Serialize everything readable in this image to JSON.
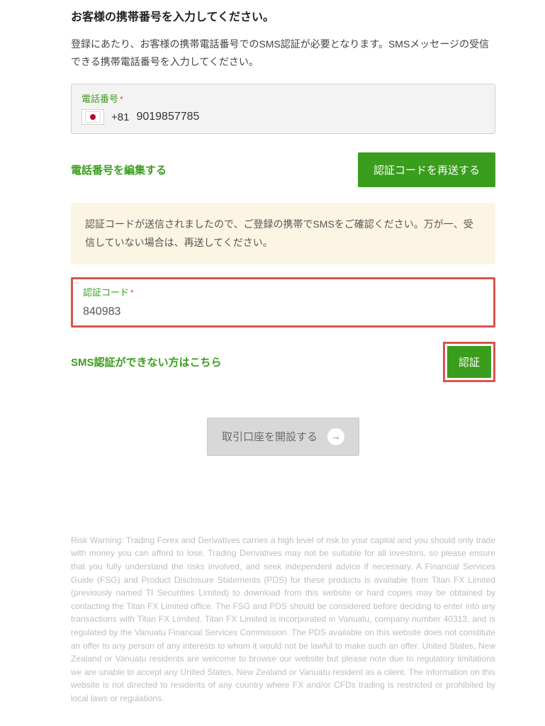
{
  "heading": "お客様の携帯番号を入力してください。",
  "description": "登録にあたり、お客様の携帯電話番号でのSMS認証が必要となります。SMSメッセージの受信できる携帯電話番号を入力してください。",
  "phone": {
    "label": "電話番号",
    "required": "*",
    "country_code": "+81",
    "number": "9019857785"
  },
  "edit_phone_link": "電話番号を編集する",
  "resend_button": "認証コードを再送する",
  "alert": "認証コードが送信されましたので、ご登録の携帯でSMSをご確認ください。万が一、受信していない場合は、再送してください。",
  "code": {
    "label": "認証コード",
    "required": "*",
    "value": "840983"
  },
  "alt_link": "SMS認証ができない方はこちら",
  "verify_button": "認証",
  "open_account_button": "取引口座を開設する",
  "risk_warning": "Risk Warning: Trading Forex and Derivatives carries a high level of risk to your capital and you should only trade with money you can afford to lose. Trading Derivatives may not be suitable for all investors, so please ensure that you fully understand the risks involved, and seek independent advice if necessary. A Financial Services Guide (FSG) and Product Disclosure Statements (PDS) for these products is available from Titan FX Limited (previously named TI Securities Limited) to download from this website or hard copies may be obtained by contacting the Titan FX Limited office. The FSG and PDS should be considered before deciding to enter into any transactions with Titan FX Limited. Titan FX Limited is incorporated in Vanuatu, company number 40313, and is regulated by the Vanuatu Financial Services Commission. The PDS available on this website does not constitute an offer to any person of any interests to whom it would not be lawful to make such an offer. United States, New Zealand or Vanuatu residents are welcome to browse our website but please note due to regulatory limitations we are unable to accept any United States, New Zealand or Vanuatu resident as a client. The information on this website is not directed to residents of any country where FX and/or CFDs trading is restricted or prohibited by local laws or regulations."
}
